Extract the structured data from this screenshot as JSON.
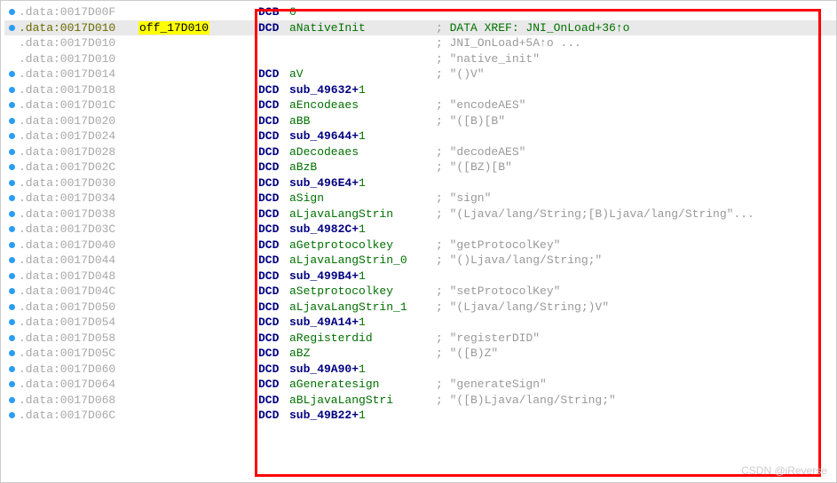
{
  "watermark": "CSDN @iReverse",
  "rows": [
    {
      "bp": true,
      "addr": ".data:0017D00F",
      "addrCls": "",
      "label": "",
      "hl": false,
      "op": "DCB",
      "sym": "",
      "symCls": "zero",
      "rawOperand": "0",
      "plus1": false,
      "comment": ""
    },
    {
      "bp": true,
      "addr": ".data:0017D010",
      "addrCls": "addr-active",
      "label": "off_17D010",
      "hl": true,
      "op": "DCD",
      "sym": "aNativeInit",
      "symCls": "sym",
      "plus1": false,
      "comment": "; DATA XREF: JNI_OnLoad+36↑o",
      "xrefRow": true,
      "selected": true
    },
    {
      "bp": false,
      "addr": ".data:0017D010",
      "addrCls": "",
      "label": "",
      "hl": false,
      "op": "",
      "sym": "",
      "symCls": "",
      "plus1": false,
      "comment": "; JNI_OnLoad+5A↑o ...",
      "xref2Row": true
    },
    {
      "bp": false,
      "addr": ".data:0017D010",
      "addrCls": "",
      "label": "",
      "hl": false,
      "op": "",
      "sym": "",
      "symCls": "",
      "plus1": false,
      "comment": "; \"native_init\""
    },
    {
      "bp": true,
      "addr": ".data:0017D014",
      "addrCls": "",
      "label": "",
      "hl": false,
      "op": "DCD",
      "sym": "aV",
      "symCls": "sym",
      "plus1": false,
      "comment": "; \"()V\""
    },
    {
      "bp": true,
      "addr": ".data:0017D018",
      "addrCls": "",
      "label": "",
      "hl": false,
      "op": "DCD",
      "sym": "sub_49632",
      "symCls": "sub",
      "plus1": true,
      "comment": ""
    },
    {
      "bp": true,
      "addr": ".data:0017D01C",
      "addrCls": "",
      "label": "",
      "hl": false,
      "op": "DCD",
      "sym": "aEncodeaes",
      "symCls": "sym",
      "plus1": false,
      "comment": "; \"encodeAES\""
    },
    {
      "bp": true,
      "addr": ".data:0017D020",
      "addrCls": "",
      "label": "",
      "hl": false,
      "op": "DCD",
      "sym": "aBB",
      "symCls": "sym",
      "plus1": false,
      "comment": "; \"([B)[B\""
    },
    {
      "bp": true,
      "addr": ".data:0017D024",
      "addrCls": "",
      "label": "",
      "hl": false,
      "op": "DCD",
      "sym": "sub_49644",
      "symCls": "sub",
      "plus1": true,
      "comment": ""
    },
    {
      "bp": true,
      "addr": ".data:0017D028",
      "addrCls": "",
      "label": "",
      "hl": false,
      "op": "DCD",
      "sym": "aDecodeaes",
      "symCls": "sym",
      "plus1": false,
      "comment": "; \"decodeAES\""
    },
    {
      "bp": true,
      "addr": ".data:0017D02C",
      "addrCls": "",
      "label": "",
      "hl": false,
      "op": "DCD",
      "sym": "aBzB",
      "symCls": "sym",
      "plus1": false,
      "comment": "; \"([BZ)[B\""
    },
    {
      "bp": true,
      "addr": ".data:0017D030",
      "addrCls": "",
      "label": "",
      "hl": false,
      "op": "DCD",
      "sym": "sub_496E4",
      "symCls": "sub",
      "plus1": true,
      "comment": ""
    },
    {
      "bp": true,
      "addr": ".data:0017D034",
      "addrCls": "",
      "label": "",
      "hl": false,
      "op": "DCD",
      "sym": "aSign",
      "symCls": "sym",
      "plus1": false,
      "comment": "; \"sign\""
    },
    {
      "bp": true,
      "addr": ".data:0017D038",
      "addrCls": "",
      "label": "",
      "hl": false,
      "op": "DCD",
      "sym": "aLjavaLangStrin",
      "symCls": "sym",
      "plus1": false,
      "comment": "; \"(Ljava/lang/String;[B)Ljava/lang/String\"..."
    },
    {
      "bp": true,
      "addr": ".data:0017D03C",
      "addrCls": "",
      "label": "",
      "hl": false,
      "op": "DCD",
      "sym": "sub_4982C",
      "symCls": "sub",
      "plus1": true,
      "comment": ""
    },
    {
      "bp": true,
      "addr": ".data:0017D040",
      "addrCls": "",
      "label": "",
      "hl": false,
      "op": "DCD",
      "sym": "aGetprotocolkey",
      "symCls": "sym",
      "plus1": false,
      "comment": "; \"getProtocolKey\""
    },
    {
      "bp": true,
      "addr": ".data:0017D044",
      "addrCls": "",
      "label": "",
      "hl": false,
      "op": "DCD",
      "sym": "aLjavaLangStrin_0",
      "symCls": "sym",
      "plus1": false,
      "comment": "; \"()Ljava/lang/String;\""
    },
    {
      "bp": true,
      "addr": ".data:0017D048",
      "addrCls": "",
      "label": "",
      "hl": false,
      "op": "DCD",
      "sym": "sub_499B4",
      "symCls": "sub",
      "plus1": true,
      "comment": ""
    },
    {
      "bp": true,
      "addr": ".data:0017D04C",
      "addrCls": "",
      "label": "",
      "hl": false,
      "op": "DCD",
      "sym": "aSetprotocolkey",
      "symCls": "sym",
      "plus1": false,
      "comment": "; \"setProtocolKey\""
    },
    {
      "bp": true,
      "addr": ".data:0017D050",
      "addrCls": "",
      "label": "",
      "hl": false,
      "op": "DCD",
      "sym": "aLjavaLangStrin_1",
      "symCls": "sym",
      "plus1": false,
      "comment": "; \"(Ljava/lang/String;)V\""
    },
    {
      "bp": true,
      "addr": ".data:0017D054",
      "addrCls": "",
      "label": "",
      "hl": false,
      "op": "DCD",
      "sym": "sub_49A14",
      "symCls": "sub",
      "plus1": true,
      "comment": ""
    },
    {
      "bp": true,
      "addr": ".data:0017D058",
      "addrCls": "",
      "label": "",
      "hl": false,
      "op": "DCD",
      "sym": "aRegisterdid",
      "symCls": "sym",
      "plus1": false,
      "comment": "; \"registerDID\""
    },
    {
      "bp": true,
      "addr": ".data:0017D05C",
      "addrCls": "",
      "label": "",
      "hl": false,
      "op": "DCD",
      "sym": "aBZ",
      "symCls": "sym",
      "plus1": false,
      "comment": "; \"([B)Z\""
    },
    {
      "bp": true,
      "addr": ".data:0017D060",
      "addrCls": "",
      "label": "",
      "hl": false,
      "op": "DCD",
      "sym": "sub_49A90",
      "symCls": "sub",
      "plus1": true,
      "comment": ""
    },
    {
      "bp": true,
      "addr": ".data:0017D064",
      "addrCls": "",
      "label": "",
      "hl": false,
      "op": "DCD",
      "sym": "aGeneratesign",
      "symCls": "sym",
      "plus1": false,
      "comment": "; \"generateSign\""
    },
    {
      "bp": true,
      "addr": ".data:0017D068",
      "addrCls": "",
      "label": "",
      "hl": false,
      "op": "DCD",
      "sym": "aBLjavaLangStri",
      "symCls": "sym",
      "plus1": false,
      "comment": "; \"([B)Ljava/lang/String;\""
    },
    {
      "bp": true,
      "addr": ".data:0017D06C",
      "addrCls": "",
      "label": "",
      "hl": false,
      "op": "DCD",
      "sym": "sub_49B22",
      "symCls": "sub",
      "plus1": true,
      "comment": ""
    }
  ]
}
